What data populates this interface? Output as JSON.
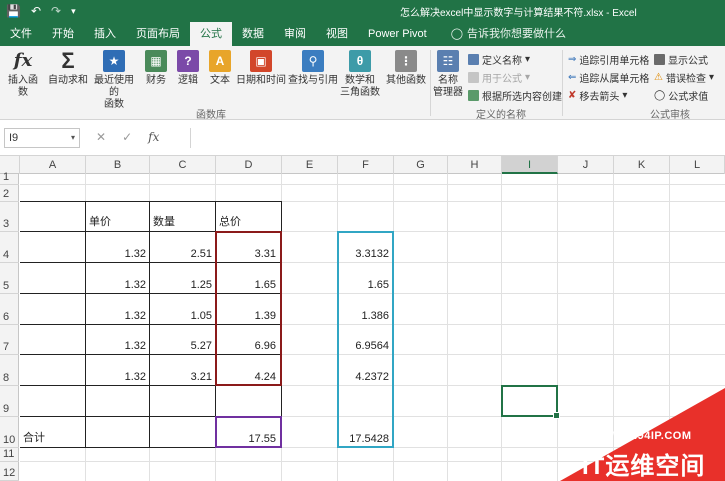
{
  "window": {
    "title": "怎么解决excel中显示数字与计算结果不符.xlsx  -  Excel",
    "save_icon": "save-icon",
    "undo_icon": "undo-icon",
    "customize_icon": "customize-qat-icon"
  },
  "tabs": [
    {
      "label": "文件",
      "active": false
    },
    {
      "label": "开始",
      "active": false
    },
    {
      "label": "插入",
      "active": false
    },
    {
      "label": "页面布局",
      "active": false
    },
    {
      "label": "公式",
      "active": true
    },
    {
      "label": "数据",
      "active": false
    },
    {
      "label": "审阅",
      "active": false
    },
    {
      "label": "视图",
      "active": false
    },
    {
      "label": "Power Pivot",
      "active": false
    }
  ],
  "tell_me": "告诉我你想要做什么",
  "ribbon": {
    "insert_function": "插入函数",
    "autosum": "自动求和",
    "recent_line1": "最近使用的",
    "recent_line2": "函数",
    "financial": "财务",
    "logical": "逻辑",
    "text": "文本",
    "datetime": "日期和时间",
    "lookup": "查找与引用",
    "math_line1": "数学和",
    "math_line2": "三角函数",
    "more": "其他函数",
    "group_library": "函数库",
    "name_manager_line1": "名称",
    "name_manager_line2": "管理器",
    "define_name": "定义名称",
    "use_in_formula": "用于公式",
    "create_from_selection": "根据所选内容创建",
    "group_names": "定义的名称",
    "trace_precedents": "追踪引用单元格",
    "trace_dependents": "追踪从属单元格",
    "remove_arrows": "移去箭头",
    "show_formulas": "显示公式",
    "error_checking": "错误检查",
    "evaluate_formula": "公式求值",
    "group_audit": "公式审核"
  },
  "formula_bar": {
    "name_box": "I9",
    "cancel": "✕",
    "enter": "✓",
    "fx": "fx",
    "formula": ""
  },
  "columns": [
    "A",
    "B",
    "C",
    "D",
    "E",
    "F",
    "G",
    "H",
    "I",
    "J",
    "K",
    "L"
  ],
  "selected_column": "I",
  "rows": [
    "1",
    "2",
    "3",
    "4",
    "5",
    "6",
    "7",
    "8",
    "9",
    "10",
    "11",
    "12"
  ],
  "cells": {
    "B3": "单价",
    "C3": "数量",
    "D3": "总价",
    "B4": "1.32",
    "C4": "2.51",
    "D4": "3.31",
    "F4": "3.3132",
    "B5": "1.32",
    "C5": "1.25",
    "D5": "1.65",
    "F5": "1.65",
    "B6": "1.32",
    "C6": "1.05",
    "D6": "1.39",
    "F6": "1.386",
    "B7": "1.32",
    "C7": "5.27",
    "D7": "6.96",
    "F7": "6.9564",
    "B8": "1.32",
    "C8": "3.21",
    "D8": "4.24",
    "F8": "4.2372",
    "A10": "合计",
    "D10": "17.55",
    "F10": "17.5428"
  },
  "highlight_colors": {
    "d_range": "#8b1a1a",
    "d_total": "#7030a0",
    "f_range": "#31a6c4",
    "selection": "#217346"
  },
  "watermark": {
    "url": "WWW.94IP.COM",
    "name": "IT运维空间"
  }
}
